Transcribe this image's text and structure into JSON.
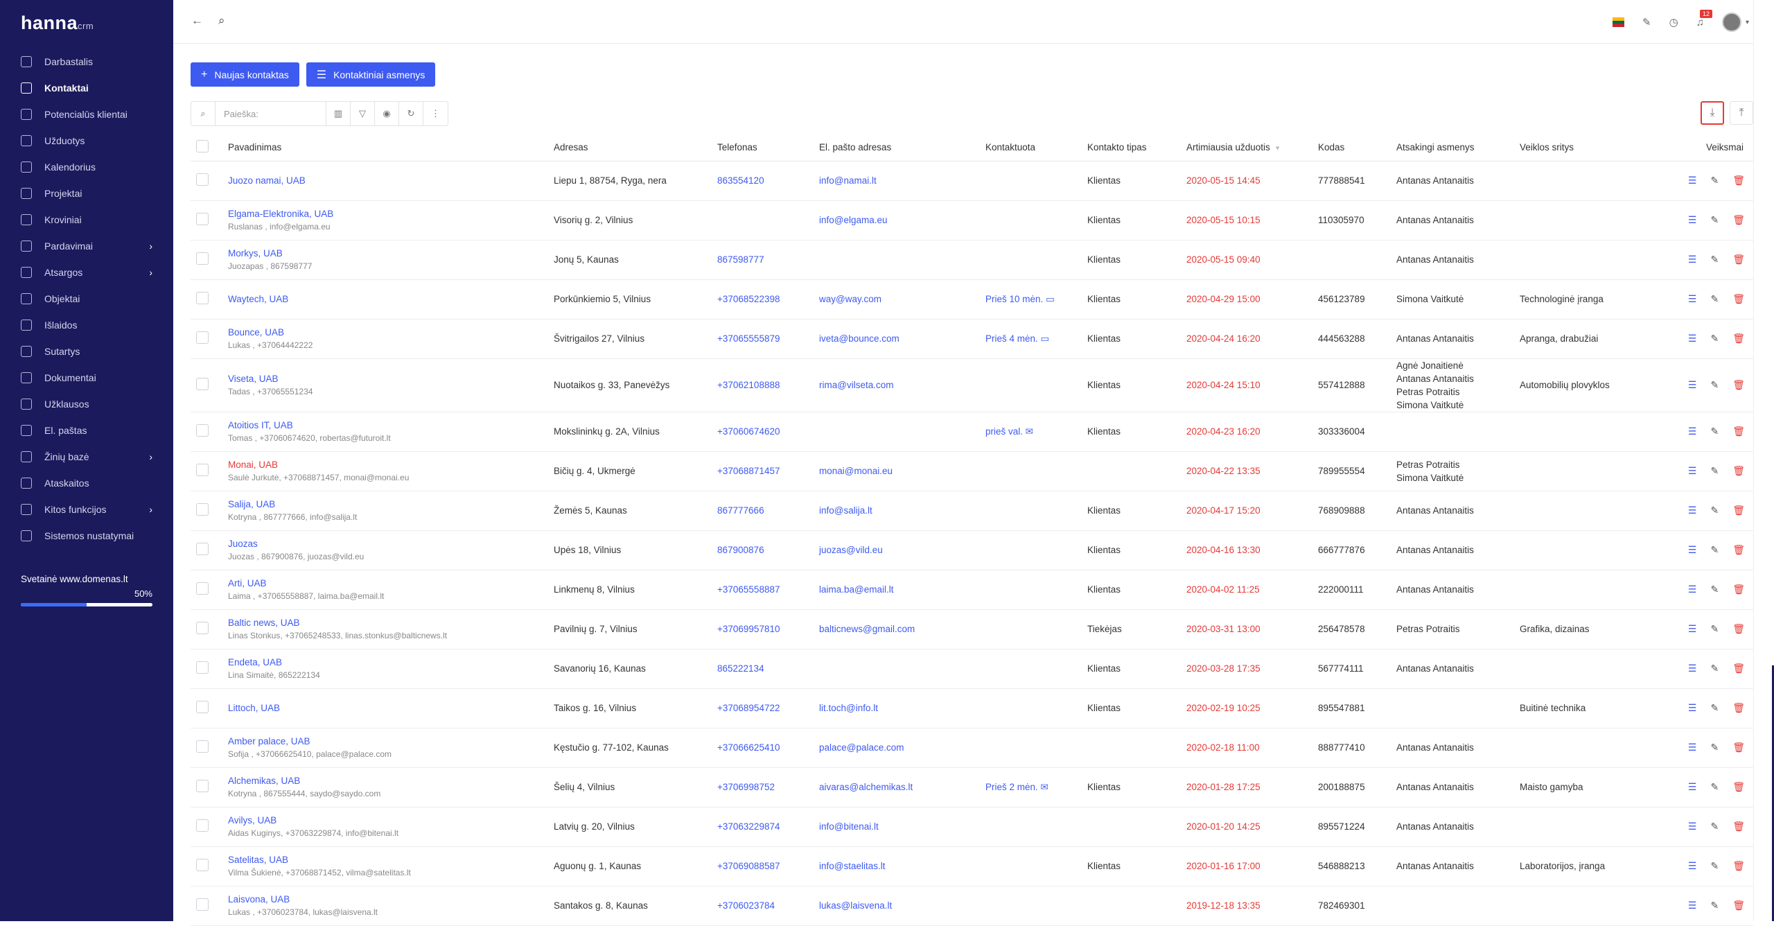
{
  "brand": {
    "name": "hanna",
    "suffix": "crm"
  },
  "sidebar": {
    "items": [
      {
        "label": "Darbastalis",
        "icon": "gauge-icon"
      },
      {
        "label": "Kontaktai",
        "icon": "users-icon",
        "active": true
      },
      {
        "label": "Potencialūs klientai",
        "icon": "user-plus-icon"
      },
      {
        "label": "Užduotys",
        "icon": "list-icon"
      },
      {
        "label": "Kalendorius",
        "icon": "calendar-icon"
      },
      {
        "label": "Projektai",
        "icon": "folder-icon"
      },
      {
        "label": "Kroviniai",
        "icon": "truck-icon"
      },
      {
        "label": "Pardavimai",
        "icon": "scale-icon",
        "submenu": true
      },
      {
        "label": "Atsargos",
        "icon": "grid-icon",
        "submenu": true
      },
      {
        "label": "Objektai",
        "icon": "building-icon"
      },
      {
        "label": "Išlaidos",
        "icon": "sort-icon"
      },
      {
        "label": "Sutartys",
        "icon": "file-icon"
      },
      {
        "label": "Dokumentai",
        "icon": "document-icon"
      },
      {
        "label": "Užklausos",
        "icon": "globe-icon"
      },
      {
        "label": "El. paštas",
        "icon": "mail-icon"
      },
      {
        "label": "Žinių bazė",
        "icon": "book-icon",
        "submenu": true
      },
      {
        "label": "Ataskaitos",
        "icon": "settings-icon"
      },
      {
        "label": "Kitos funkcijos",
        "icon": "gear-icon",
        "submenu": true
      },
      {
        "label": "Sistemos nustatymai",
        "icon": "gear-icon"
      }
    ],
    "site": {
      "title": "Svetainė www.domenas.lt",
      "percent_label": "50%",
      "progress": 0.5
    }
  },
  "topbar": {
    "notifications_count": "12"
  },
  "actions": {
    "new_contact": "Naujas kontaktas",
    "contact_persons": "Kontaktiniai asmenys"
  },
  "search": {
    "placeholder": "Paieška:"
  },
  "columns": {
    "name": "Pavadinimas",
    "address": "Adresas",
    "phone": "Telefonas",
    "email": "El. pašto adresas",
    "contacted": "Kontaktuota",
    "type": "Kontakto tipas",
    "next_task": "Artimiausia užduotis",
    "code": "Kodas",
    "responsible": "Atsakingi asmenys",
    "activity": "Veiklos sritys",
    "actions": "Veiksmai"
  },
  "rows": [
    {
      "name": "Juozo namai, UAB",
      "sub": "",
      "address": "Liepu 1, 88754, Ryga, nera",
      "phone": "863554120",
      "email": "info@namai.lt",
      "contacted": "",
      "type": "Klientas",
      "date": "2020-05-15 14:45",
      "code": "777888541",
      "responsible": "Antanas Antanaitis",
      "activity": ""
    },
    {
      "name": "Elgama-Elektronika, UAB",
      "sub": "Ruslanas , info@elgama.eu",
      "address": "Visorių g. 2, Vilnius",
      "phone": "",
      "email": "info@elgama.eu",
      "contacted": "",
      "type": "Klientas",
      "date": "2020-05-15 10:15",
      "code": "110305970",
      "responsible": "Antanas Antanaitis",
      "activity": ""
    },
    {
      "name": "Morkys, UAB",
      "sub": "Juozapas , 867598777",
      "address": "Jonų 5, Kaunas",
      "phone": "867598777",
      "email": "",
      "contacted": "",
      "type": "Klientas",
      "date": "2020-05-15 09:40",
      "code": "",
      "responsible": "Antanas Antanaitis",
      "activity": ""
    },
    {
      "name": "Waytech, UAB",
      "sub": "",
      "address": "Porkūnkiemio 5, Vilnius",
      "phone": "+37068522398",
      "email": "way@way.com",
      "contacted": "Prieš 10 mėn.",
      "type": "Klientas",
      "date": "2020-04-29 15:00",
      "code": "456123789",
      "responsible": "Simona Vaitkutė",
      "activity": "Technologinė įranga"
    },
    {
      "name": "Bounce, UAB",
      "sub": "Lukas , +37064442222",
      "address": "Švitrigailos 27, Vilnius",
      "phone": "+37065555879",
      "email": "iveta@bounce.com",
      "contacted": "Prieš 4 mėn.",
      "type": "Klientas",
      "date": "2020-04-24 16:20",
      "code": "444563288",
      "responsible": "Antanas Antanaitis",
      "activity": "Apranga, drabužiai"
    },
    {
      "name": "Viseta, UAB",
      "sub": "Tadas , +37065551234",
      "address": "Nuotaikos g. 33, Panevėžys",
      "phone": "+37062108888",
      "email": "rima@vilseta.com",
      "contacted": "",
      "type": "Klientas",
      "date": "2020-04-24 15:10",
      "code": "557412888",
      "responsible": "Agnė Jonaitienė\nAntanas Antanaitis\nPetras Potraitis\nSimona Vaitkutė",
      "activity": "Automobilių plovyklos"
    },
    {
      "name": "Atoitios IT, UAB",
      "sub": "Tomas , +37060674620, robertas@futuroit.lt",
      "address": "Mokslininkų g. 2A, Vilnius",
      "phone": "+37060674620",
      "email": "",
      "contacted": "prieš val.",
      "type": "Klientas",
      "date": "2020-04-23 16:20",
      "code": "303336004",
      "responsible": "",
      "activity": ""
    },
    {
      "name": "Monai, UAB",
      "sub": "Saulė Jurkutė, +37068871457, monai@monai.eu",
      "address": "Bičių g. 4, Ukmergė",
      "phone": "+37068871457",
      "email": "monai@monai.eu",
      "contacted": "",
      "type": "",
      "date": "2020-04-22 13:35",
      "code": "789955554",
      "responsible": "Petras Potraitis\nSimona Vaitkutė",
      "activity": ""
    },
    {
      "name": "Salija, UAB",
      "sub": "Kotryna , 867777666, info@salija.lt",
      "address": "Žemės 5, Kaunas",
      "phone": "867777666",
      "email": "info@salija.lt",
      "contacted": "",
      "type": "Klientas",
      "date": "2020-04-17 15:20",
      "code": "768909888",
      "responsible": "Antanas Antanaitis",
      "activity": ""
    },
    {
      "name": "Juozas",
      "sub": "Juozas , 867900876, juozas@vild.eu",
      "address": "Upės 18, Vilnius",
      "phone": "867900876",
      "email": "juozas@vild.eu",
      "contacted": "",
      "type": "Klientas",
      "date": "2020-04-16 13:30",
      "code": "666777876",
      "responsible": "Antanas Antanaitis",
      "activity": ""
    },
    {
      "name": "Arti, UAB",
      "sub": "Laima , +37065558887, laima.ba@email.lt",
      "address": "Linkmenų 8, Vilnius",
      "phone": "+37065558887",
      "email": "laima.ba@email.lt",
      "contacted": "",
      "type": "Klientas",
      "date": "2020-04-02 11:25",
      "code": "222000111",
      "responsible": "Antanas Antanaitis",
      "activity": ""
    },
    {
      "name": "Baltic news, UAB",
      "sub": "Linas Stonkus, +37065248533, linas.stonkus@balticnews.lt",
      "address": "Pavilnių g. 7, Vilnius",
      "phone": "+37069957810",
      "email": "balticnews@gmail.com",
      "contacted": "",
      "type": "Tiekėjas",
      "date": "2020-03-31 13:00",
      "code": "256478578",
      "responsible": "Petras Potraitis",
      "activity": "Grafika, dizainas"
    },
    {
      "name": "Endeta, UAB",
      "sub": "Lina Simaitė, 865222134",
      "address": "Savanorių 16, Kaunas",
      "phone": "865222134",
      "email": "",
      "contacted": "",
      "type": "Klientas",
      "date": "2020-03-28 17:35",
      "code": "567774111",
      "responsible": "Antanas Antanaitis",
      "activity": ""
    },
    {
      "name": "Littoch, UAB",
      "sub": "",
      "address": "Taikos g. 16, Vilnius",
      "phone": "+37068954722",
      "email": "lit.toch@info.lt",
      "contacted": "",
      "type": "Klientas",
      "date": "2020-02-19 10:25",
      "code": "895547881",
      "responsible": "",
      "activity": "Buitinė technika"
    },
    {
      "name": "Amber palace, UAB",
      "sub": "Sofija , +37066625410, palace@palace.com",
      "address": "Kęstučio g. 77-102, Kaunas",
      "phone": "+37066625410",
      "email": "palace@palace.com",
      "contacted": "",
      "type": "",
      "date": "2020-02-18 11:00",
      "code": "888777410",
      "responsible": "Antanas Antanaitis",
      "activity": ""
    },
    {
      "name": "Alchemikas, UAB",
      "sub": "Kotryna , 867555444, saydo@saydo.com",
      "address": "Šelių 4, Vilnius",
      "phone": "+3706998752",
      "email": "aivaras@alchemikas.lt",
      "contacted": "Prieš 2 mėn.",
      "type": "Klientas",
      "date": "2020-01-28 17:25",
      "code": "200188875",
      "responsible": "Antanas Antanaitis",
      "activity": "Maisto gamyba"
    },
    {
      "name": "Avilys, UAB",
      "sub": "Aidas Kuginys, +37063229874, info@bitenai.lt",
      "address": "Latvių g. 20, Vilnius",
      "phone": "+37063229874",
      "email": "info@bitenai.lt",
      "contacted": "",
      "type": "",
      "date": "2020-01-20 14:25",
      "code": "895571224",
      "responsible": "Antanas Antanaitis",
      "activity": ""
    },
    {
      "name": "Satelitas, UAB",
      "sub": "Vilma Šukienė, +37068871452, vilma@satelitas.lt",
      "address": "Aguonų g. 1, Kaunas",
      "phone": "+37069088587",
      "email": "info@staelitas.lt",
      "contacted": "",
      "type": "Klientas",
      "date": "2020-01-16 17:00",
      "code": "546888213",
      "responsible": "Antanas Antanaitis",
      "activity": "Laboratorijos, įranga"
    },
    {
      "name": "Laisvona, UAB",
      "sub": "Lukas , +3706023784, lukas@laisvena.lt",
      "address": "Santakos g. 8, Kaunas",
      "phone": "+3706023784",
      "email": "lukas@laisvena.lt",
      "contacted": "",
      "type": "",
      "date": "2019-12-18 13:35",
      "code": "782469301",
      "responsible": "",
      "activity": ""
    }
  ]
}
